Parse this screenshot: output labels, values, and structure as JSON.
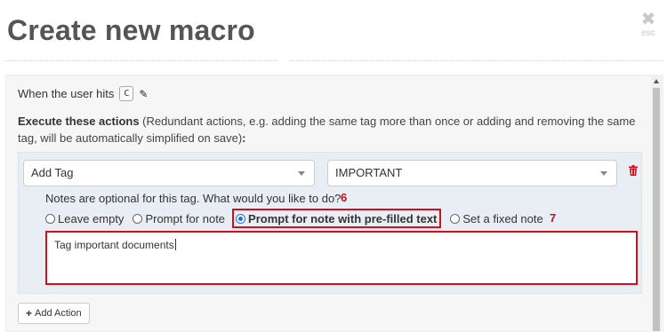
{
  "header": {
    "title": "Create new macro",
    "close_icon": "close-icon",
    "close_glyph": "✖",
    "esc_label": "esc"
  },
  "trigger": {
    "label": "When the user hits",
    "key": "C",
    "edit_icon": "pencil-icon",
    "edit_glyph": "✎"
  },
  "actions_intro": {
    "bold": "Execute these actions",
    "note": " (Redundant actions, e.g. adding the same tag more than once or adding and removing the same tag, will be automatically simplified on save)",
    "colon": ":"
  },
  "action": {
    "type_value": "Add Tag",
    "tag_value": "IMPORTANT",
    "delete_icon": "trash-icon",
    "notes_question": "Notes are optional for this tag. What would you like to do?",
    "options": [
      {
        "label": "Leave empty",
        "checked": false
      },
      {
        "label": "Prompt for note",
        "checked": false
      },
      {
        "label": "Prompt for note with pre-filled text",
        "checked": true
      },
      {
        "label": "Set a fixed note",
        "checked": false
      }
    ],
    "note_text": "Tag important documents"
  },
  "annotations": {
    "marker_6": "6",
    "marker_7": "7",
    "highlight_color": "#d0101c"
  },
  "footer": {
    "add_action_icon": "plus-icon",
    "add_action_glyph": "+",
    "add_action_label": "Add Action"
  }
}
